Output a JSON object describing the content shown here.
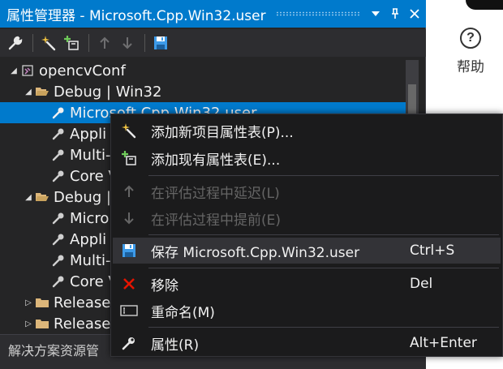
{
  "panel": {
    "title": "属性管理器 - Microsoft.Cpp.Win32.user",
    "title_buttons": [
      "chevron-down-icon",
      "pin-icon",
      "close-icon"
    ]
  },
  "toolbar": {
    "tools": [
      "wrench-icon",
      "new-sheet-icon",
      "add-existing-icon",
      "arrow-up-icon",
      "arrow-down-icon",
      "save-icon"
    ]
  },
  "tree": {
    "rows": [
      {
        "label": "opencvConf",
        "type": "project",
        "expanded": true
      },
      {
        "label": "Debug | Win32",
        "type": "folder",
        "expanded": true
      },
      {
        "label": "Microsoft.Cpp.Win32.user",
        "type": "sheet",
        "selected": true
      },
      {
        "label": "Appli",
        "type": "sheet"
      },
      {
        "label": "Multi-",
        "type": "sheet"
      },
      {
        "label": "Core V",
        "type": "sheet"
      },
      {
        "label": "Debug |",
        "type": "folder",
        "expanded": true
      },
      {
        "label": "Micro",
        "type": "sheet"
      },
      {
        "label": "Appli",
        "type": "sheet"
      },
      {
        "label": "Multi-",
        "type": "sheet"
      },
      {
        "label": "Core V",
        "type": "sheet"
      },
      {
        "label": "Release",
        "type": "folder",
        "expanded": false
      },
      {
        "label": "Release",
        "type": "folder",
        "expanded": false
      }
    ]
  },
  "bottom_tab": "解决方案资源管",
  "right_panel": {
    "help_icon_glyph": "?",
    "help_label": "帮助"
  },
  "context_menu": {
    "items": [
      {
        "label": "添加新项目属性表(P)...",
        "shortcut": "",
        "icon": "new-sheet-icon",
        "disabled": false
      },
      {
        "label": "添加现有属性表(E)...",
        "shortcut": "",
        "icon": "add-existing-icon",
        "disabled": false
      },
      {
        "label": "在评估过程中延迟(L)",
        "shortcut": "",
        "icon": "arrow-up-icon",
        "disabled": true
      },
      {
        "label": "在评估过程中提前(E)",
        "shortcut": "",
        "icon": "arrow-down-icon",
        "disabled": true
      },
      {
        "label": "保存 Microsoft.Cpp.Win32.user",
        "shortcut": "Ctrl+S",
        "icon": "save-icon",
        "disabled": false,
        "highlighted": true
      },
      {
        "label": "移除",
        "shortcut": "Del",
        "icon": "remove-icon",
        "disabled": false
      },
      {
        "label": "重命名(M)",
        "shortcut": "",
        "icon": "rename-icon",
        "disabled": false
      },
      {
        "label": "属性(R)",
        "shortcut": "Alt+Enter",
        "icon": "wrench-icon",
        "disabled": false
      }
    ]
  },
  "colors": {
    "accent": "#007acc",
    "panel_bg": "#252526",
    "menu_bg": "#1b1b1c",
    "remove_red": "#e51400",
    "save_blue": "#3d9be9"
  }
}
